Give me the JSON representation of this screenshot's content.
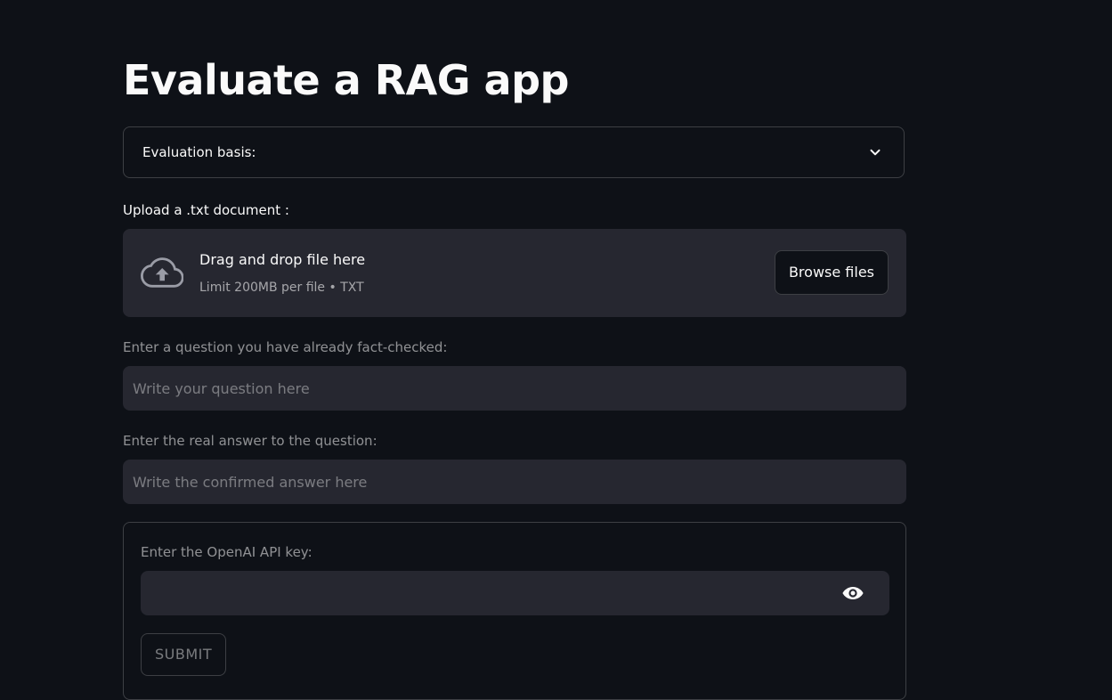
{
  "page": {
    "title": "Evaluate a RAG app"
  },
  "expander": {
    "label": "Evaluation basis:",
    "icon": "chevron-down-icon"
  },
  "uploader": {
    "label": "Upload a .txt document :",
    "drop_text": "Drag and drop file here",
    "limit_text": "Limit 200MB per file • TXT",
    "browse_label": "Browse files",
    "icon": "cloud-upload-icon"
  },
  "question": {
    "label": "Enter a question you have already fact-checked:",
    "placeholder": "Write your question here",
    "value": ""
  },
  "answer": {
    "label": "Enter the real answer to the question:",
    "placeholder": "Write the confirmed answer here",
    "value": ""
  },
  "form": {
    "api_key_label": "Enter the OpenAI API key:",
    "api_key_value": "",
    "reveal_icon": "eye-icon",
    "submit_label": "SUBMIT"
  },
  "colors": {
    "background": "#0e1117",
    "surface": "#262730",
    "text": "#fafafa"
  }
}
